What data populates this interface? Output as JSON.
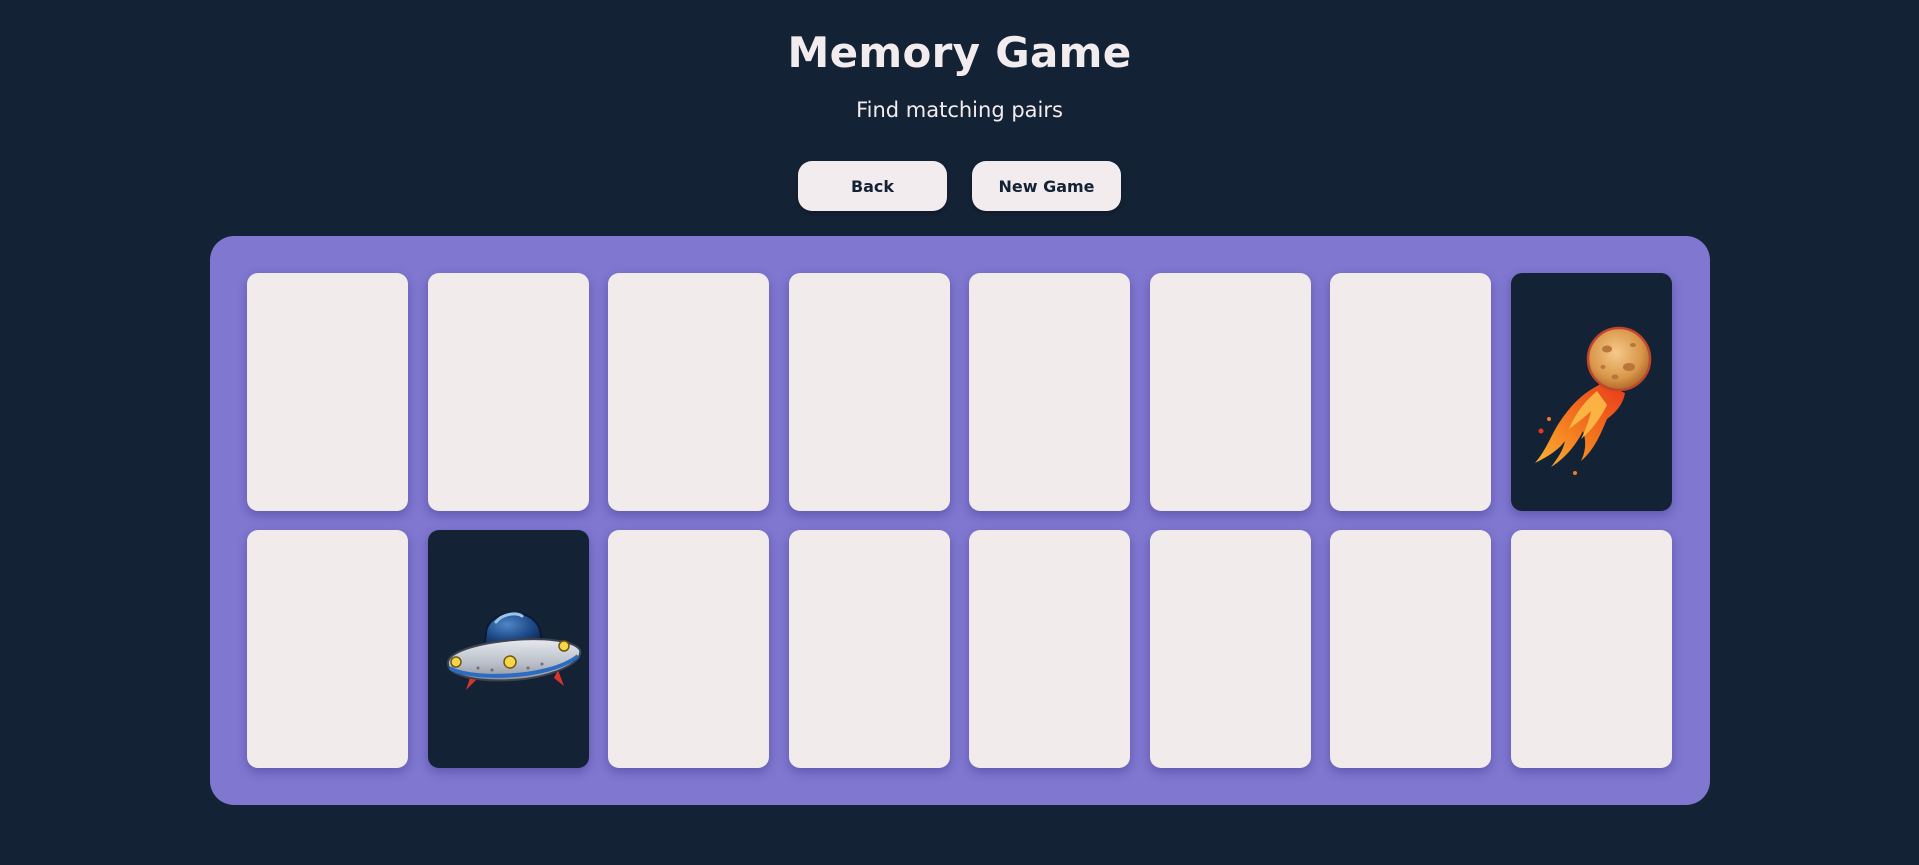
{
  "header": {
    "title": "Memory Game",
    "subtitle": "Find matching pairs"
  },
  "controls": {
    "back_label": "Back",
    "new_game_label": "New Game"
  },
  "board": {
    "columns": 8,
    "rows": 2,
    "cards": [
      {
        "state": "hidden",
        "icon": ""
      },
      {
        "state": "hidden",
        "icon": ""
      },
      {
        "state": "hidden",
        "icon": ""
      },
      {
        "state": "hidden",
        "icon": ""
      },
      {
        "state": "hidden",
        "icon": ""
      },
      {
        "state": "hidden",
        "icon": ""
      },
      {
        "state": "hidden",
        "icon": ""
      },
      {
        "state": "flipped",
        "icon": "meteor-icon"
      },
      {
        "state": "hidden",
        "icon": ""
      },
      {
        "state": "flipped",
        "icon": "ufo-icon"
      },
      {
        "state": "hidden",
        "icon": ""
      },
      {
        "state": "hidden",
        "icon": ""
      },
      {
        "state": "hidden",
        "icon": ""
      },
      {
        "state": "hidden",
        "icon": ""
      },
      {
        "state": "hidden",
        "icon": ""
      },
      {
        "state": "hidden",
        "icon": ""
      }
    ]
  },
  "colors": {
    "background": "#142235",
    "board": "#7f77d0",
    "card_back": "#f1ebec",
    "card_face": "#142235",
    "text": "#f3ecee"
  }
}
